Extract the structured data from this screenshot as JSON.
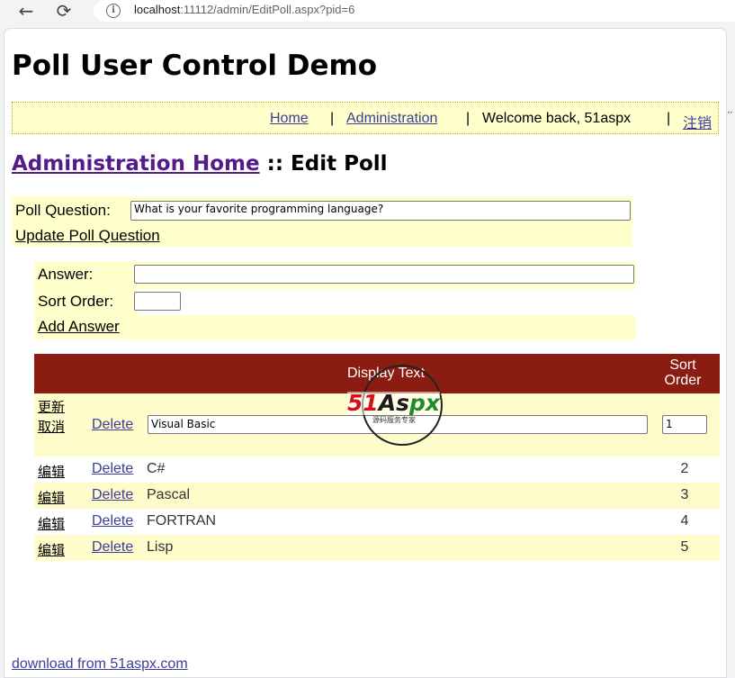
{
  "browser": {
    "url_host": "localhost",
    "url_rest": ":11112/admin/EditPoll.aspx?pid=6",
    "back_glyph": "←",
    "reload_glyph": "⟳",
    "info_glyph": "i"
  },
  "page": {
    "title": "Poll User Control Demo",
    "nav": {
      "home": "Home",
      "sep": "|",
      "admin": "Administration",
      "welcome": "Welcome back, 51aspx",
      "logout": "注销"
    },
    "breadcrumb": {
      "link": "Administration Home",
      "rest": " :: Edit Poll"
    },
    "question": {
      "label": "Poll Question:",
      "value": "What is your favorite programming language?",
      "update": "Update Poll Question"
    },
    "answer_form": {
      "answer_label": "Answer:",
      "answer_value": "",
      "sort_label": "Sort Order:",
      "sort_value": "",
      "add": "Add Answer"
    },
    "grid": {
      "header": {
        "display_text": "Display Text",
        "sort_order_line1": "Sort",
        "sort_order_line2": "Order"
      },
      "edit_row": {
        "update": "更新",
        "cancel": "取消",
        "delete": "Delete",
        "text_value": "Visual Basic",
        "order_value": "1"
      },
      "rows": [
        {
          "cmd": "编辑",
          "delete": "Delete",
          "text": "C#",
          "order": "2"
        },
        {
          "cmd": "编辑",
          "delete": "Delete",
          "text": "Pascal",
          "order": "3"
        },
        {
          "cmd": "编辑",
          "delete": "Delete",
          "text": "FORTRAN",
          "order": "4"
        },
        {
          "cmd": "编辑",
          "delete": "Delete",
          "text": "Lisp",
          "order": "5"
        }
      ]
    },
    "watermark": {
      "brand_a": "51",
      "brand_b": "As",
      "brand_c": "px",
      "tagline": "源码服务专家"
    },
    "footer_link": "download from 51aspx.com"
  },
  "colors": {
    "header_bg": "#8b1c12",
    "panel_bg": "#ffffcc",
    "link": "#3d3d99",
    "visited": "#551a8b"
  }
}
